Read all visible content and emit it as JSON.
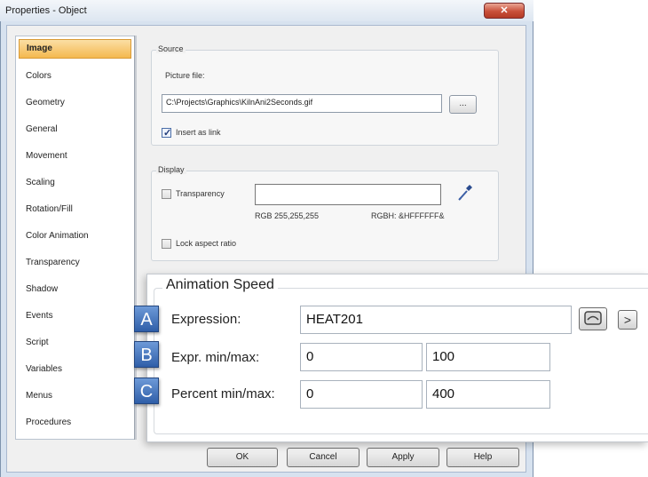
{
  "window": {
    "title": "Properties - Object",
    "close_glyph": "✕"
  },
  "nav": {
    "items": [
      {
        "label": "Image"
      },
      {
        "label": "Colors"
      },
      {
        "label": "Geometry"
      },
      {
        "label": "General"
      },
      {
        "label": "Movement"
      },
      {
        "label": "Scaling"
      },
      {
        "label": "Rotation/Fill"
      },
      {
        "label": "Color Animation"
      },
      {
        "label": "Transparency"
      },
      {
        "label": "Shadow"
      },
      {
        "label": "Events"
      },
      {
        "label": "Script"
      },
      {
        "label": "Variables"
      },
      {
        "label": "Menus"
      },
      {
        "label": "Procedures"
      }
    ],
    "selected": "Image"
  },
  "source": {
    "legend": "Source",
    "picture_label": "Picture file:",
    "picture_value": "C:\\Projects\\Graphics\\KilnAni2Seconds.gif",
    "browse_label": "...",
    "insert_link_label": "Insert as link",
    "insert_link_checked": true
  },
  "display": {
    "legend": "Display",
    "transparency_label": "Transparency",
    "transparency_checked": false,
    "rgb_text": "RGB 255,255,255",
    "rgbh_text": "RGBH: &HFFFFFF&",
    "eyedropper_icon": "eyedropper-icon",
    "lock_aspect_label": "Lock aspect ratio",
    "lock_aspect_checked": false
  },
  "animation_speed": {
    "legend": "Animation Speed",
    "rows": [
      {
        "badge": "A",
        "label": "Expression:",
        "value": ""
      },
      {
        "badge": "B",
        "label": "Expr. min/max:",
        "min": "0",
        "max": "100"
      },
      {
        "badge": "C",
        "label": "Percent min/max:",
        "min": "0",
        "max": "400"
      }
    ],
    "expression_value": "HEAT201",
    "more_glyph": ">"
  },
  "buttons": {
    "ok": "OK",
    "cancel": "Cancel",
    "apply": "Apply",
    "help": "Help"
  }
}
